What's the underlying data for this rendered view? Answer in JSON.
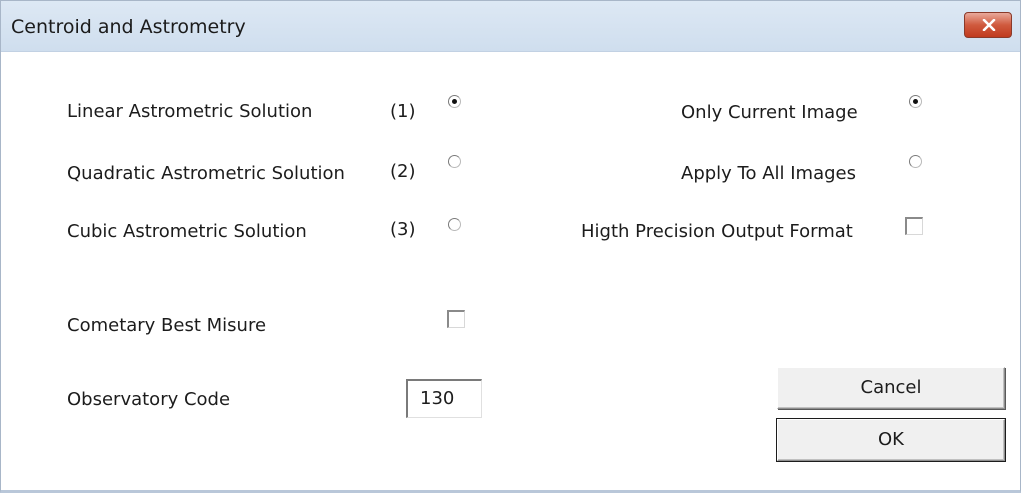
{
  "window": {
    "title": "Centroid and Astrometry"
  },
  "solutions": [
    {
      "label": "Linear Astrometric Solution",
      "number": "(1)",
      "selected": true
    },
    {
      "label": "Quadratic Astrometric Solution",
      "number": "(2)",
      "selected": false
    },
    {
      "label": "Cubic Astrometric Solution",
      "number": "(3)",
      "selected": false
    }
  ],
  "scope": {
    "only_current_label": "Only Current Image",
    "only_current_selected": true,
    "apply_all_label": "Apply To All Images",
    "apply_all_selected": false
  },
  "high_precision": {
    "label": "Higth Precision Output Format",
    "checked": false
  },
  "cometary": {
    "label": "Cometary Best Misure",
    "checked": false
  },
  "observatory": {
    "label": "Observatory Code",
    "value": "130"
  },
  "buttons": {
    "cancel_label": "Cancel",
    "ok_label": "OK"
  },
  "icons": {
    "close": "close-icon"
  }
}
